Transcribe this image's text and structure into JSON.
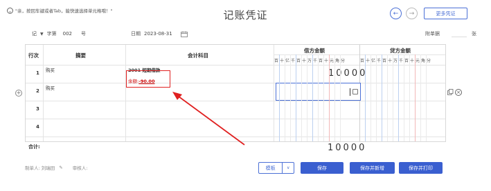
{
  "tip": "\"亲，按回车键或者Tab，能快速选择单元格哦！\"",
  "page_title": "记账凭证",
  "nav": {
    "prev_icon": "←",
    "next_icon": "→",
    "more_label": "更多凭证"
  },
  "voucher": {
    "word": "记",
    "no_label": "字第",
    "no_value": "002",
    "no_suffix": "号",
    "date_label": "日期",
    "date_value": "2023-08-31",
    "attachments_label": "附单据",
    "attachments_suffix": "张"
  },
  "table": {
    "headers": {
      "row_no": "行次",
      "summary": "摘要",
      "subject": "会计科目",
      "debit": "借方金额",
      "credit": "贷方金额"
    },
    "digit_units": [
      "百",
      "十",
      "亿",
      "千",
      "百",
      "十",
      "万",
      "千",
      "百",
      "十",
      "元",
      "角",
      "分"
    ],
    "rows": [
      {
        "no": "1",
        "summary": "购买",
        "subject": "2001 短期借款",
        "balance_label": "余额:",
        "balance_value": "-90.00",
        "debit": "10000",
        "credit": ""
      },
      {
        "no": "2",
        "summary": "购买",
        "subject": "",
        "debit": "",
        "credit": ""
      },
      {
        "no": "3",
        "summary": "",
        "subject": "",
        "debit": "",
        "credit": ""
      },
      {
        "no": "4",
        "summary": "",
        "subject": "",
        "debit": "",
        "credit": ""
      }
    ],
    "total_label": "合计:",
    "total_debit": "10000"
  },
  "footer": {
    "maker_label": "制单人: 刘瑞田",
    "reviewer_label": "审核人:",
    "template_label": "模板",
    "save_label": "保存",
    "save_new_label": "保存并新增",
    "save_print_label": "保存并打印"
  },
  "colors": {
    "accent": "#3a5fd0",
    "annotation": "#e02020"
  }
}
